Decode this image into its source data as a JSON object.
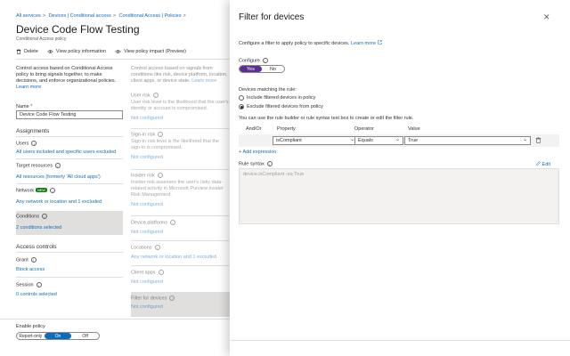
{
  "breadcrumb": [
    "All services",
    "Devices | Conditional access",
    "Conditional Access | Policies"
  ],
  "page": {
    "title": "Device Code Flow Testing",
    "subtitle": "Conditional Access policy"
  },
  "toolbar": {
    "delete": "Delete",
    "view_info": "View policy information",
    "view_impact": "View policy impact (Preview)"
  },
  "left": {
    "description": "Control access based on Conditional Access policy to bring signals together, to make decisions, and enforce organizational policies.",
    "learn_more": "Learn more",
    "name_label": "Name",
    "name_required": "*",
    "name_value": "Device Code Flow Testing",
    "assignments": "Assignments",
    "users_label": "Users",
    "users_value": "All users included and specific users excluded",
    "target_label": "Target resources",
    "target_value": "All resources (formerly 'All cloud apps')",
    "network_label": "Network",
    "network_badge": "NEW",
    "network_value": "Any network or location and 1 excluded",
    "conditions_label": "Conditions",
    "conditions_value": "2 conditions selected",
    "access_controls": "Access controls",
    "grant_label": "Grant",
    "grant_value": "Block access",
    "session_label": "Session",
    "session_value": "0 controls selected"
  },
  "middle": {
    "description": "Control access based on signals from conditions like risk, device platform, location, client apps, or device state.",
    "learn_more": "Learn more",
    "items": [
      {
        "title": "User risk",
        "desc": "User risk level is the likelihood that the user's identity or account is compromised.",
        "value": "Not configured"
      },
      {
        "title": "Sign-in risk",
        "desc": "Sign-in risk level is the likelihood that the sign-in is compromised.",
        "value": "Not configured"
      },
      {
        "title": "Insider risk",
        "desc": "Insider risk assesses the user's risky data-related activity in Microsoft Purview Insider Risk Management.",
        "value": "Not configured"
      },
      {
        "title": "Device platforms",
        "desc": "",
        "value": "Not configured"
      },
      {
        "title": "Locations",
        "desc": "",
        "value": "Any network or location and 1 excluded"
      },
      {
        "title": "Client apps",
        "desc": "",
        "value": "Not configured"
      },
      {
        "title": "Filter for devices",
        "desc": "",
        "value": "Not configured"
      }
    ]
  },
  "enable": {
    "label": "Enable policy",
    "options": [
      "Report-only",
      "On",
      "Off"
    ],
    "selected": "On"
  },
  "panel": {
    "title": "Filter for devices",
    "close": "✕",
    "description": "Configure a filter to apply policy to specific devices.",
    "learn_more": "Learn more",
    "configure_label": "Configure",
    "configure_yes": "Yes",
    "configure_no": "No",
    "configure_selected": "Yes",
    "matching_label": "Devices matching the rule:",
    "radio_include": "Include filtered devices in policy",
    "radio_exclude": "Exclude filtered devices from policy",
    "radio_selected": "exclude",
    "rule_help": "You can use the rule builder or rule syntax text box to create or edit the filter rule.",
    "col_andor": "And/Or",
    "col_property": "Property",
    "col_operator": "Operator",
    "col_value": "Value",
    "row_property": "isCompliant",
    "row_operator": "Equals",
    "row_value": "True",
    "add_expression": "Add expression",
    "rule_syntax_label": "Rule syntax",
    "edit": "Edit",
    "rule_syntax_value": "device.isCompliant -eq True"
  },
  "colors": {
    "accent": "#0f6cbd",
    "toggle_yes": "#5c2e91",
    "selected_row": "#e1dfdd"
  }
}
